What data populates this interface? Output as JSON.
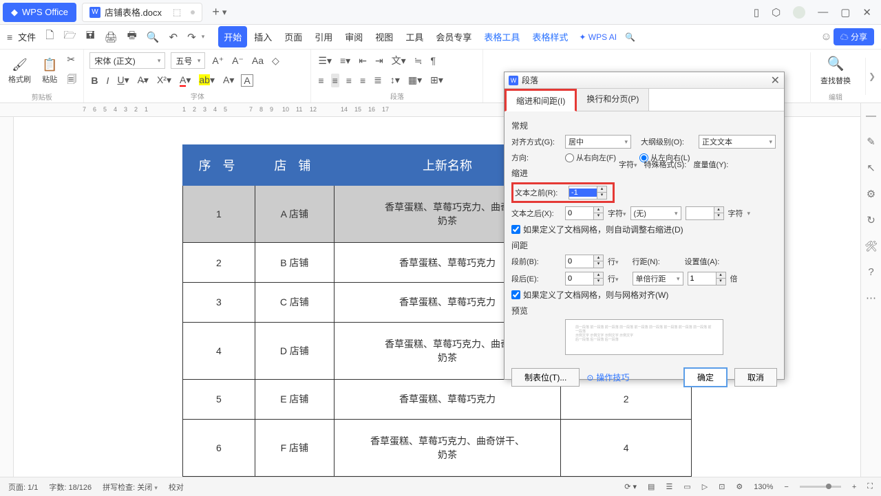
{
  "app": {
    "name": "WPS Office"
  },
  "doc": {
    "title": "店铺表格.docx"
  },
  "menu": {
    "file": "文件",
    "tabs": [
      "开始",
      "插入",
      "页面",
      "引用",
      "审阅",
      "视图",
      "工具",
      "会员专享",
      "表格工具",
      "表格样式"
    ],
    "ai": "WPS AI",
    "share": "分享"
  },
  "ribbon": {
    "clipboard_label": "剪贴板",
    "format_brush": "格式刷",
    "paste": "粘贴",
    "font_name": "宋体 (正文)",
    "font_size": "五号",
    "font_label": "字体",
    "paragraph_label": "段落",
    "find_replace": "查找替换",
    "edit_label": "编辑"
  },
  "table": {
    "headers": [
      "序 号",
      "店 铺",
      "上新名称",
      ""
    ],
    "rows": [
      {
        "num": "1",
        "shop": "A 店铺",
        "items": "香草蛋糕、草莓巧克力、曲奇\n奶茶",
        "selected": true
      },
      {
        "num": "2",
        "shop": "B 店铺",
        "items": "香草蛋糕、草莓巧克力"
      },
      {
        "num": "3",
        "shop": "C 店铺",
        "items": "香草蛋糕、草莓巧克力"
      },
      {
        "num": "4",
        "shop": "D 店铺",
        "items": "香草蛋糕、草莓巧克力、曲奇\n奶茶"
      },
      {
        "num": "5",
        "shop": "E 店铺",
        "items": "香草蛋糕、草莓巧克力",
        "extra": "2"
      },
      {
        "num": "6",
        "shop": "F 店铺",
        "items": "香草蛋糕、草莓巧克力、曲奇饼干、\n奶茶",
        "extra": "4"
      }
    ]
  },
  "dialog": {
    "title": "段落",
    "tab1": "缩进和间距(I)",
    "tab2": "换行和分页(P)",
    "sec_general": "常规",
    "align_label": "对齐方式(G):",
    "align_value": "居中",
    "outline_label": "大纲级别(O):",
    "outline_value": "正文文本",
    "direction_label": "方向:",
    "rtl": "从右向左(F)",
    "ltr": "从左向右(L)",
    "sec_indent": "缩进",
    "before_text_label": "文本之前(R):",
    "before_text_value": "-1",
    "after_text_label": "文本之后(X):",
    "after_text_value": "0",
    "unit_char": "字符",
    "special_label": "特殊格式(S):",
    "special_value": "(无)",
    "measure_label": "度量值(Y):",
    "indent_checkbox": "如果定义了文档网格，则自动调整右缩进(D)",
    "sec_spacing": "间距",
    "before_para_label": "段前(B):",
    "before_para_value": "0",
    "after_para_label": "段后(E):",
    "after_para_value": "0",
    "unit_line": "行",
    "line_spacing_label": "行距(N):",
    "line_spacing_value": "单倍行距",
    "set_value_label": "设置值(A):",
    "set_value": "1",
    "unit_bei": "倍",
    "spacing_checkbox": "如果定义了文档网格，则与网格对齐(W)",
    "sec_preview": "预览",
    "tabs_btn": "制表位(T)...",
    "tips_link": "操作技巧",
    "ok": "确定",
    "cancel": "取消"
  },
  "status": {
    "page": "页面: 1/1",
    "words": "字数: 18/126",
    "spell": "拼写检查: 关闭",
    "proof": "校对",
    "zoom": "130%"
  }
}
